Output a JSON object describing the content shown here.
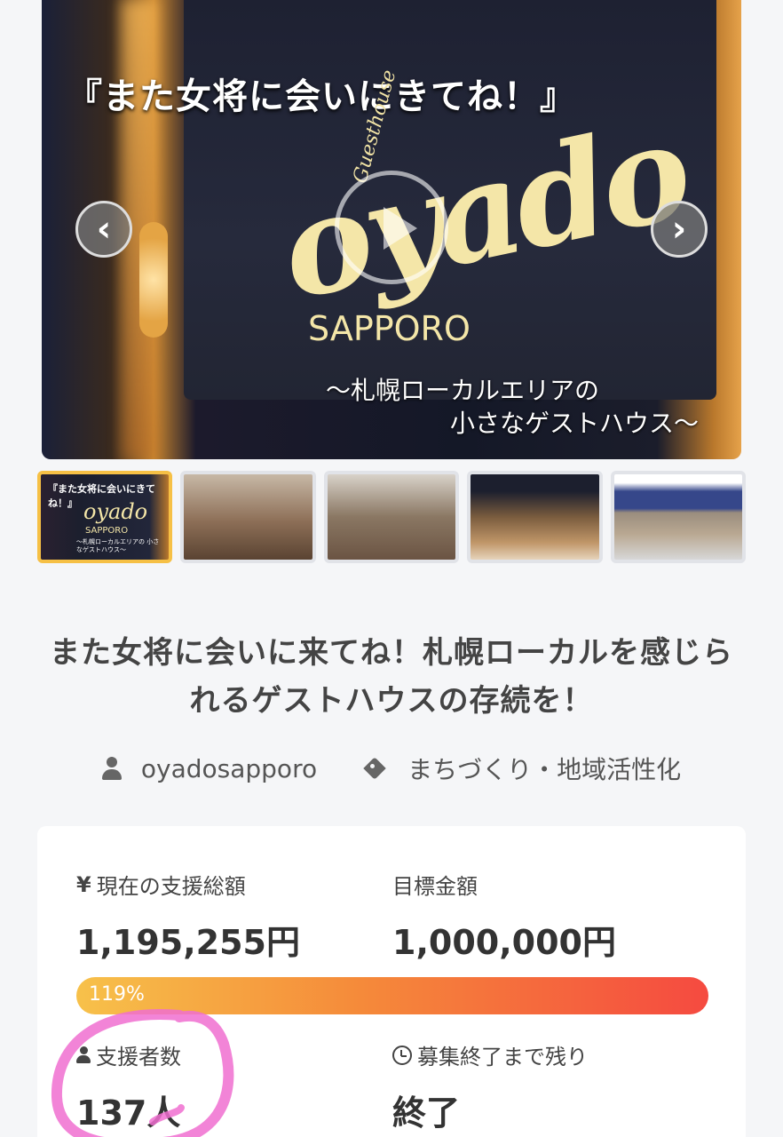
{
  "hero": {
    "title": "『また女将に会いにきてね！』",
    "brand_small": "Guesthouse",
    "brand": "oyado",
    "city": "SAPPORO",
    "subtitle_line1": "〜札幌ローカルエリアの",
    "subtitle_line2": "小さなゲストハウス〜",
    "prev_icon": "chevron-left-icon",
    "next_icon": "chevron-right-icon",
    "play_icon": "play-icon"
  },
  "thumbnails": {
    "items": [
      {
        "title": "『また女将に会いにきてね！』",
        "brand": "oyado",
        "city": "SAPPORO",
        "subtitle": "〜札幌ローカルエリアの 小さなゲストハウス〜",
        "active": true
      },
      {
        "active": false
      },
      {
        "active": false
      },
      {
        "active": false
      },
      {
        "active": false
      }
    ]
  },
  "project": {
    "title": "また女将に会いに来てね！札幌ローカルを感じられるゲストハウスの存続を！",
    "owner": "oyadosapporo",
    "category": "まちづくり・地域活性化"
  },
  "stats": {
    "current_label": "現在の支援総額",
    "current_icon": "yen-icon",
    "current_symbol": "¥",
    "current_value": "1,195,255円",
    "goal_label": "目標金額",
    "goal_value": "1,000,000円",
    "progress_text": "119%",
    "progress_percent": 119,
    "supporters_label": "支援者数",
    "supporters_value": "137人",
    "remaining_label": "募集終了まで残り",
    "remaining_value": "終了"
  },
  "colors": {
    "progress_start": "#f7c14a",
    "progress_end": "#f54a40",
    "thumb_active_border": "#f6c045",
    "scribble": "#f06fd0"
  }
}
